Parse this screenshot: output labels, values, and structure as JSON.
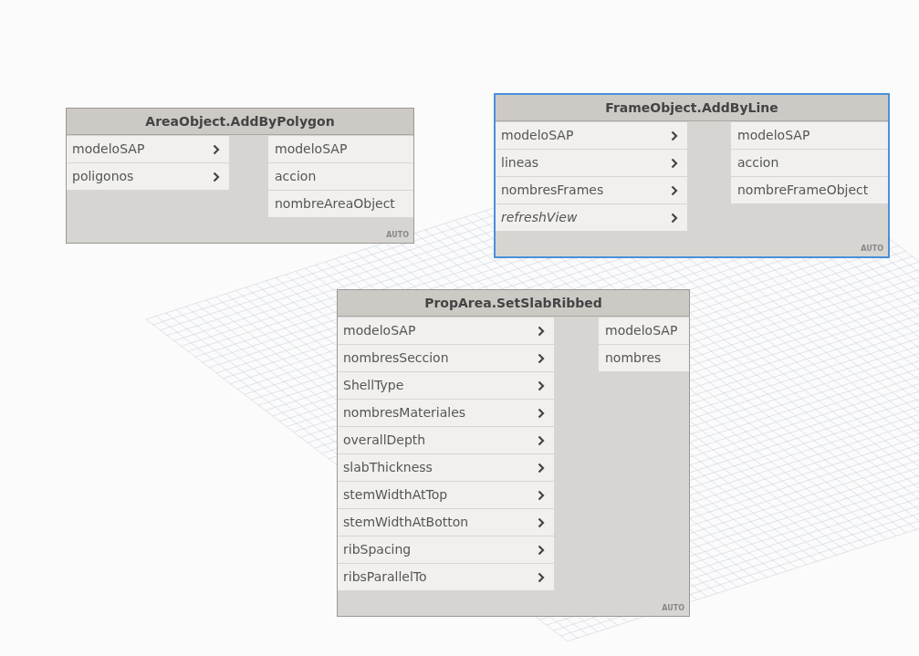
{
  "nodes": [
    {
      "title": "AreaObject.AddByPolygon",
      "selected": false,
      "inputs": [
        {
          "label": "modeloSAP",
          "optional": false
        },
        {
          "label": "poligonos",
          "optional": false
        }
      ],
      "outputs": [
        "modeloSAP",
        "accion",
        "nombreAreaObject"
      ],
      "lacing": "AUTO"
    },
    {
      "title": "FrameObject.AddByLine",
      "selected": true,
      "inputs": [
        {
          "label": "modeloSAP",
          "optional": false
        },
        {
          "label": "lineas",
          "optional": false
        },
        {
          "label": "nombresFrames",
          "optional": false
        },
        {
          "label": "refreshView",
          "optional": true
        }
      ],
      "outputs": [
        "modeloSAP",
        "accion",
        "nombreFrameObject"
      ],
      "lacing": "AUTO"
    },
    {
      "title": "PropArea.SetSlabRibbed",
      "selected": false,
      "inputs": [
        {
          "label": "modeloSAP",
          "optional": false
        },
        {
          "label": "nombresSeccion",
          "optional": false
        },
        {
          "label": "ShellType",
          "optional": false
        },
        {
          "label": "nombresMateriales",
          "optional": false
        },
        {
          "label": "overallDepth",
          "optional": false
        },
        {
          "label": "slabThickness",
          "optional": false
        },
        {
          "label": "stemWidthAtTop",
          "optional": false
        },
        {
          "label": "stemWidthAtBotton",
          "optional": false
        },
        {
          "label": "ribSpacing",
          "optional": false
        },
        {
          "label": "ribsParallelTo",
          "optional": false
        }
      ],
      "outputs": [
        "modeloSAP",
        "nombres"
      ],
      "lacing": "AUTO"
    }
  ]
}
